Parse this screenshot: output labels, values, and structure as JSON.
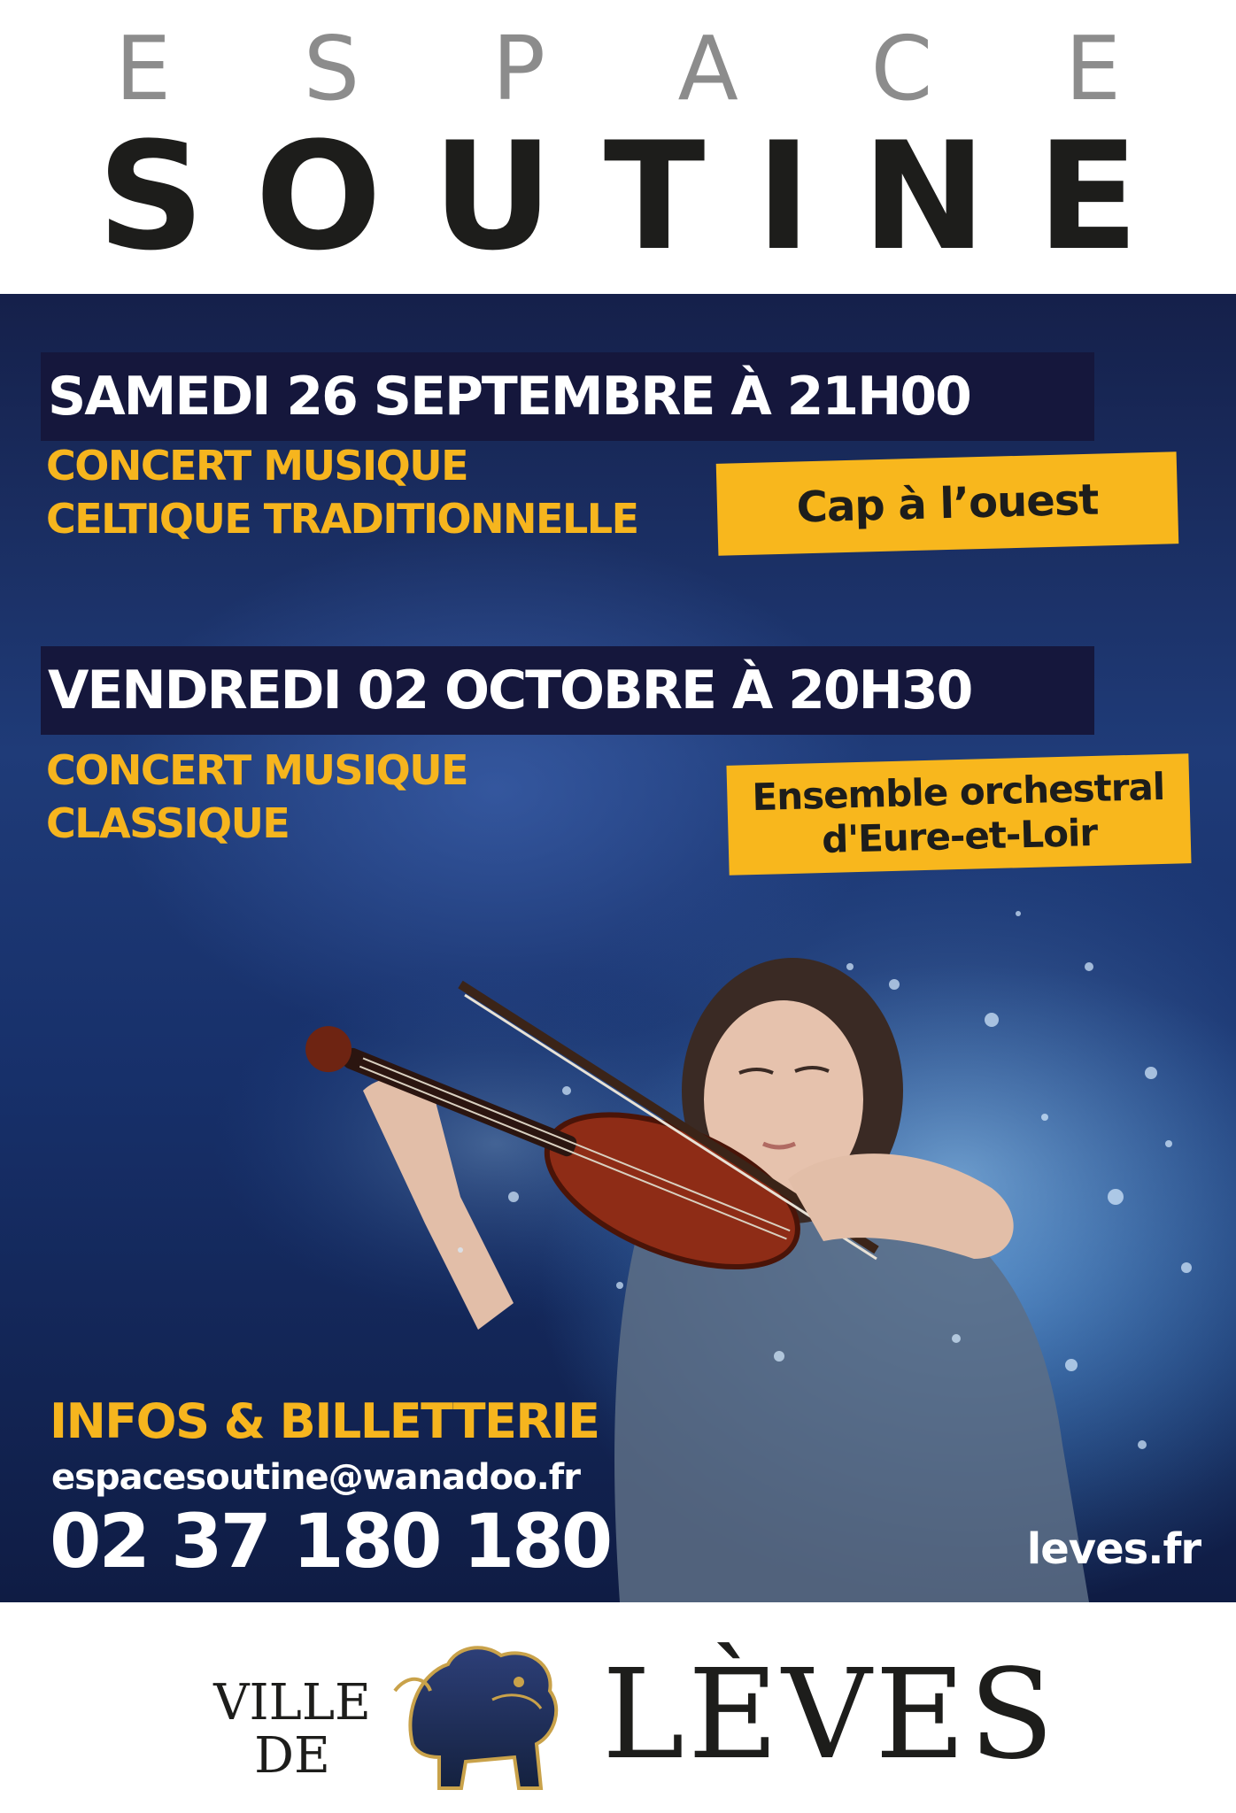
{
  "header": {
    "espace_letters": [
      "E",
      "S",
      "P",
      "A",
      "C",
      "E"
    ],
    "soutine_letters": [
      "S",
      "O",
      "U",
      "T",
      "I",
      "N",
      "E"
    ]
  },
  "events": [
    {
      "date": "SAMEDI 26 SEPTEMBRE À 21H00",
      "genre_line1": "CONCERT MUSIQUE",
      "genre_line2": "CELTIQUE TRADITIONNELLE",
      "performer_line1": "Cap à l’ouest",
      "performer_line2": ""
    },
    {
      "date": "VENDREDI 02 OCTOBRE À 20H30",
      "genre_line1": "CONCERT MUSIQUE",
      "genre_line2": "CLASSIQUE",
      "performer_line1": "Ensemble orchestral",
      "performer_line2": "d'Eure-et-Loir"
    }
  ],
  "info": {
    "title": "INFOS & BILLETTERIE",
    "email": "espacesoutine@wanadoo.fr",
    "phone": "02 37 180 180",
    "website": "leves.fr"
  },
  "footer": {
    "ville": "VILLE",
    "de": "DE",
    "town": "LÈVES"
  },
  "colors": {
    "accent_yellow": "#f8b71d",
    "navy": "#15173c",
    "title_grey": "#8c8c8c",
    "title_black": "#1d1d1b"
  }
}
